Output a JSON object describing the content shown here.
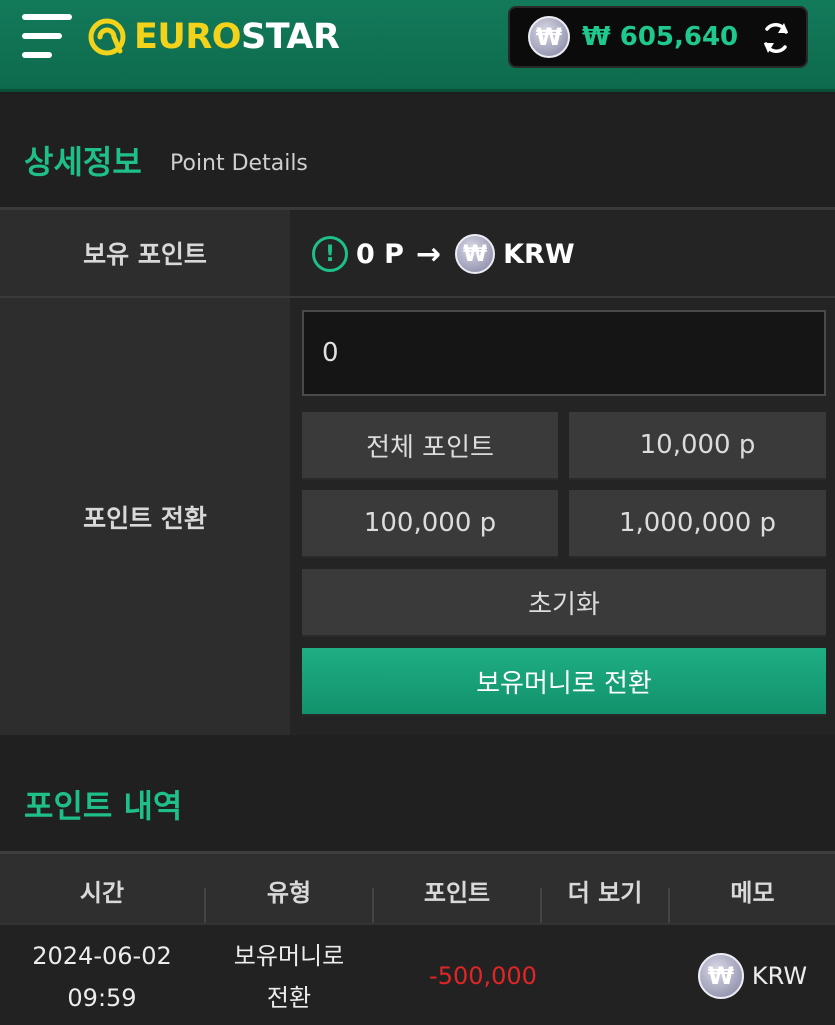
{
  "header": {
    "logo_part1": "EURO",
    "logo_part2": "STAR",
    "balance": "₩ 605,640",
    "currency_symbol": "₩",
    "brand_color": "#127a5a",
    "accent_color": "#1fbf88"
  },
  "details": {
    "title": "상세정보",
    "subtitle": "Point Details",
    "held_points_label": "보유 포인트",
    "points_value": "0 P",
    "arrow": "→",
    "currency": "KRW",
    "alert_symbol": "!",
    "convert_label": "포인트 전환",
    "input_value": "0",
    "buttons": {
      "all_points": "전체 포인트",
      "p10k": "10,000 p",
      "p100k": "100,000 p",
      "p1m": "1,000,000 p",
      "reset": "초기화",
      "convert": "보유머니로 전환"
    }
  },
  "history": {
    "title": "포인트 내역",
    "columns": [
      "시간",
      "유형",
      "포인트",
      "더 보기",
      "메모"
    ],
    "rows": [
      {
        "date": "2024-06-02",
        "time": "09:59",
        "type_line1": "보유머니로",
        "type_line2": "전환",
        "points": "-500,000",
        "memo": "KRW"
      }
    ]
  }
}
